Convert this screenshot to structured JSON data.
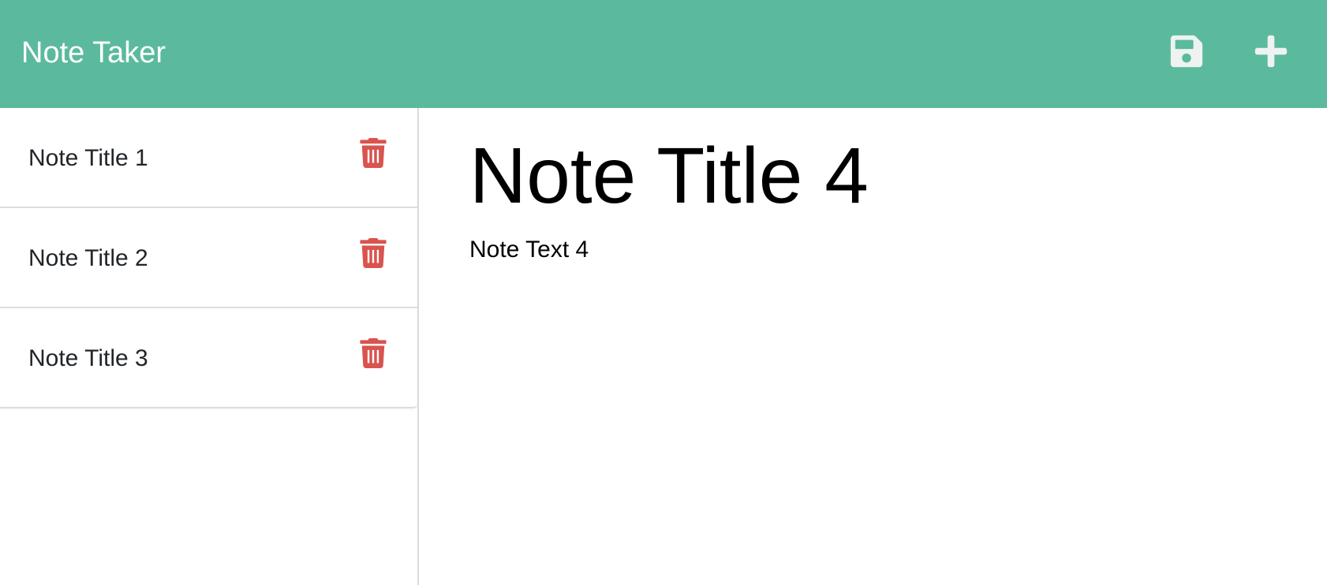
{
  "app": {
    "title": "Note Taker",
    "accent_color": "#5bba9e",
    "delete_color": "#d9534f"
  },
  "toolbar": {
    "save_icon": "save-icon",
    "new_icon": "plus-icon"
  },
  "sidebar": {
    "notes": [
      {
        "title": "Note Title 1",
        "delete_icon": "trash-icon"
      },
      {
        "title": "Note Title 2",
        "delete_icon": "trash-icon"
      },
      {
        "title": "Note Title 3",
        "delete_icon": "trash-icon"
      }
    ]
  },
  "main": {
    "note_title": "Note Title 4",
    "note_text": "Note Text 4"
  }
}
